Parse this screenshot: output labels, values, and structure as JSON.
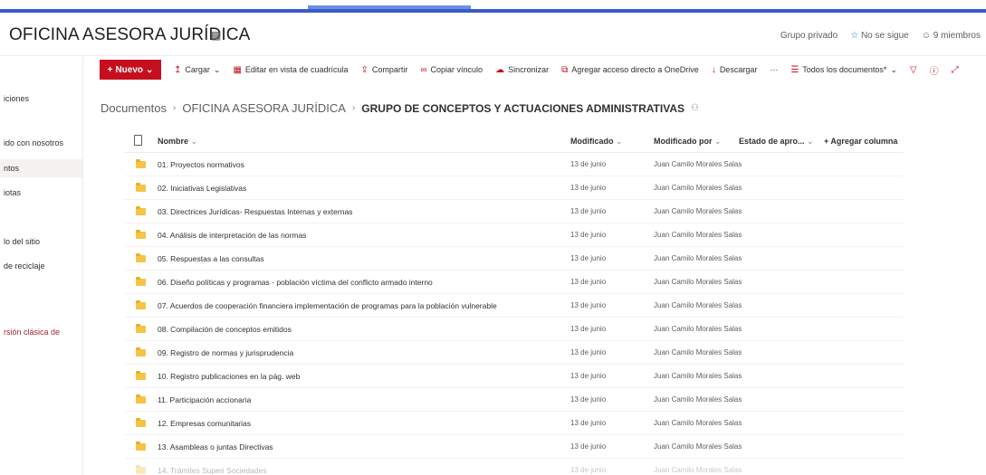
{
  "site": {
    "title": "OFICINA ASESORA JURÍDICA",
    "privacy": "Grupo privado",
    "follow": "No se sigue",
    "members": "9 miembros"
  },
  "leftnav": {
    "items": [
      {
        "label": "iciones",
        "active": false
      },
      {
        "label": "ido con nosotros",
        "active": false
      },
      {
        "label": "ntos",
        "active": true
      },
      {
        "label": "iotas",
        "active": false
      },
      {
        "label": "lo del sitio",
        "active": false
      },
      {
        "label": "de reciclaje",
        "active": false
      },
      {
        "label": "rsión clásica de",
        "active": false
      }
    ]
  },
  "commandbar": {
    "new_label": "Nuevo",
    "upload": "Cargar",
    "grid_edit": "Editar en vista de cuadrícula",
    "share": "Compartir",
    "copy_link": "Copiar vínculo",
    "sync": "Sincronizar",
    "onedrive": "Agregar acceso directo a OneDrive",
    "download": "Descargar",
    "more": "···",
    "view": "Todos los documentos*"
  },
  "breadcrumb": {
    "root": "Documentos",
    "middle": "OFICINA ASESORA JURÍDICA",
    "current": "GRUPO DE CONCEPTOS Y ACTUACIONES ADMINISTRATIVAS"
  },
  "table": {
    "headers": {
      "name": "Nombre",
      "modified": "Modificado",
      "modified_by": "Modificado por",
      "approval": "Estado de apro...",
      "add_column": "+ Agregar columna"
    },
    "rows": [
      {
        "name": "01. Proyectos normativos",
        "modified": "13 de junio",
        "modified_by": "Juan Camilo Morales Salas"
      },
      {
        "name": "02. Iniciativas Legislativas",
        "modified": "13 de junio",
        "modified_by": "Juan Camilo Morales Salas"
      },
      {
        "name": "03. Directrices Jurídicas- Respuestas Internas y externas",
        "modified": "13 de junio",
        "modified_by": "Juan Camilo Morales Salas"
      },
      {
        "name": "04. Análisis de interpretación de las normas",
        "modified": "13 de junio",
        "modified_by": "Juan Camilo Morales Salas"
      },
      {
        "name": "05. Respuestas a las consultas",
        "modified": "13 de junio",
        "modified_by": "Juan Camilo Morales Salas"
      },
      {
        "name": "06. Diseño políticas y programas - población víctima del conflicto armado interno",
        "modified": "13 de junio",
        "modified_by": "Juan Camilo Morales Salas"
      },
      {
        "name": "07. Acuerdos de cooperación financiera implementación de programas para la población vulnerable",
        "modified": "13 de junio",
        "modified_by": "Juan Camilo Morales Salas"
      },
      {
        "name": "08. Compilación de conceptos emitidos",
        "modified": "13 de junio",
        "modified_by": "Juan Camilo Morales Salas"
      },
      {
        "name": "09. Registro de normas y jurisprudencia",
        "modified": "13 de junio",
        "modified_by": "Juan Camilo Morales Salas"
      },
      {
        "name": "10. Registro publicaciones en la pág. web",
        "modified": "13 de junio",
        "modified_by": "Juan Camilo Morales Salas"
      },
      {
        "name": "11. Participación accionaria",
        "modified": "13 de junio",
        "modified_by": "Juan Camilo Morales Salas"
      },
      {
        "name": "12. Empresas comunitarias",
        "modified": "13 de junio",
        "modified_by": "Juan Camilo Morales Salas"
      },
      {
        "name": "13. Asambleas o juntas Directivas",
        "modified": "13 de junio",
        "modified_by": "Juan Camilo Morales Salas"
      },
      {
        "name": "14. Trámites Superi Sociedades",
        "modified": "13 de junio",
        "modified_by": "Juan Camilo Morales Salas"
      }
    ]
  }
}
